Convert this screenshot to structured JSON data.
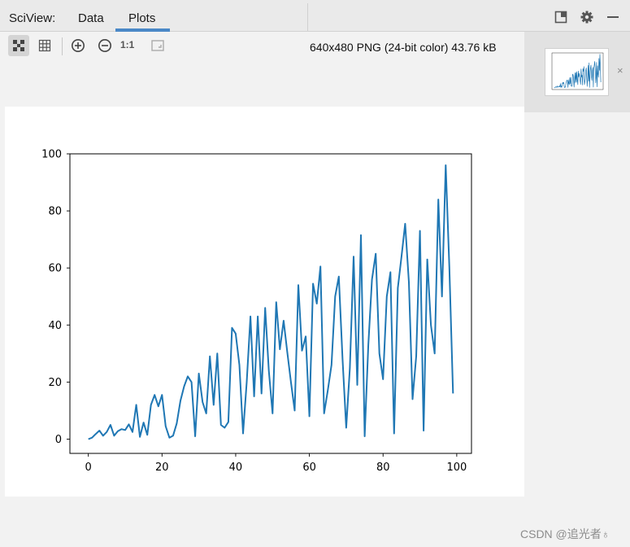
{
  "header": {
    "app_title": "SciView:",
    "tabs": [
      {
        "label": "Data",
        "active": false
      },
      {
        "label": "Plots",
        "active": true
      }
    ]
  },
  "window_controls": [
    "restore-layout-icon",
    "gear-icon",
    "minimize-icon"
  ],
  "toolbar": {
    "buttons": [
      "fit-to-window-icon",
      "grid-icon",
      "zoom-in-icon",
      "zoom-out-icon",
      "actual-size-button",
      "fit-zoom-icon"
    ],
    "actual_size_label": "1:1",
    "image_info": "640x480 PNG (24-bit color) 43.76 kB"
  },
  "thumbnail": {
    "close_label": "×"
  },
  "colors": {
    "accent": "#4a88c7",
    "line": "#1f77b4"
  },
  "watermark": "CSDN @追光者♁",
  "chart_data": {
    "type": "line",
    "title": "",
    "xlabel": "",
    "ylabel": "",
    "xlim": [
      -5,
      104
    ],
    "ylim": [
      -5,
      100
    ],
    "xticks": [
      0,
      20,
      40,
      60,
      80,
      100
    ],
    "yticks": [
      0,
      20,
      40,
      60,
      80,
      100
    ],
    "grid": false,
    "series": [
      {
        "color": "#1f77b4",
        "x": [
          0,
          1,
          2,
          3,
          4,
          5,
          6,
          7,
          8,
          9,
          10,
          11,
          12,
          13,
          14,
          15,
          16,
          17,
          18,
          19,
          20,
          21,
          22,
          23,
          24,
          25,
          26,
          27,
          28,
          29,
          30,
          31,
          32,
          33,
          34,
          35,
          36,
          37,
          38,
          39,
          40,
          41,
          42,
          43,
          44,
          45,
          46,
          47,
          48,
          49,
          50,
          51,
          52,
          53,
          54,
          55,
          56,
          57,
          58,
          59,
          60,
          61,
          62,
          63,
          64,
          65,
          66,
          67,
          68,
          69,
          70,
          71,
          72,
          73,
          74,
          75,
          76,
          77,
          78,
          79,
          80,
          81,
          82,
          83,
          84,
          85,
          86,
          87,
          88,
          89,
          90,
          91,
          92,
          93,
          94,
          95,
          96,
          97,
          98,
          99
        ],
        "y": [
          0,
          0.5,
          1.8,
          3,
          1.2,
          2.5,
          5,
          1.2,
          2.8,
          3.5,
          3.2,
          5.2,
          2.5,
          12,
          0.8,
          5.8,
          1.5,
          12,
          15.5,
          11.5,
          15.5,
          4.5,
          0.5,
          1.2,
          5.5,
          13.5,
          18.5,
          22,
          20,
          1,
          23,
          13,
          9,
          29,
          12,
          30,
          5,
          4,
          6,
          39,
          37,
          26,
          2,
          20,
          43,
          15,
          43,
          16,
          46,
          24,
          9,
          48,
          31.5,
          41.5,
          30.5,
          20,
          10,
          54,
          31,
          36,
          8,
          54.5,
          47.5,
          60.5,
          9,
          17,
          26,
          50,
          57,
          28,
          4,
          25,
          64,
          19,
          71.5,
          1,
          33,
          56,
          65,
          30,
          21,
          50,
          58.5,
          2,
          53,
          64,
          75.5,
          55,
          14,
          29,
          73,
          3,
          63,
          40,
          30,
          84,
          50,
          96,
          60,
          16
        ]
      }
    ]
  }
}
